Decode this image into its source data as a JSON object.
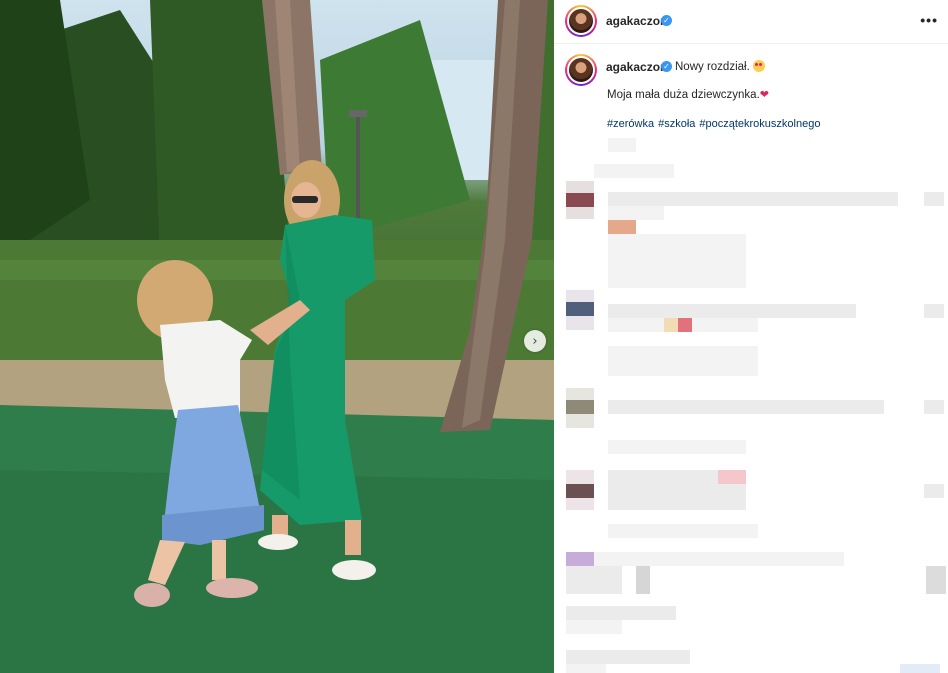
{
  "post": {
    "username": "agakaczor",
    "verified": true,
    "more_icon": "more-horizontal-icon",
    "caption": {
      "first_line": "Nowy rozdział.",
      "second_line": "Moja mała duża dziewczynka.",
      "hashtags": [
        "#zerówka",
        "#szkoła",
        "#początekrokuszkolnego"
      ]
    }
  },
  "colors": {
    "verified_blue": "#3897f0",
    "hashtag_blue": "#00376b",
    "dress_green": "#169a6a",
    "skirt_blue": "#7fa8e0"
  },
  "icons": {
    "carousel_next": "chevron-right-icon"
  }
}
